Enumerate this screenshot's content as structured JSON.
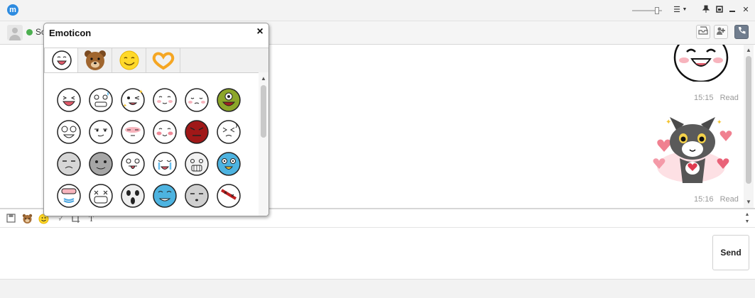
{
  "window": {
    "logo_letter": "m",
    "toolbar_icons": [
      "slider-icon",
      "menu-icon",
      "pin-icon",
      "restore-icon",
      "minimize-icon",
      "close-icon"
    ],
    "close_label": "✕"
  },
  "chat_header": {
    "contact_name": "So",
    "status_color": "#4caf50",
    "action_icons": [
      "inbox-icon",
      "add-contact-icon",
      "call-icon"
    ]
  },
  "messages": [
    {
      "type": "sticker",
      "icon": "smiling-face-sticker",
      "time": "15:15",
      "status": "Read"
    },
    {
      "type": "sticker",
      "icon": "cat-hearts-sticker",
      "time": "15:16",
      "status": "Read"
    }
  ],
  "composer": {
    "tools": [
      "save-icon",
      "bear-icon",
      "smiley-icon",
      "nudge-icon",
      "capture-icon",
      "font-icon"
    ],
    "send_label": "Send"
  },
  "emoticon_panel": {
    "title": "Emoticon",
    "close_label": "×",
    "tabs": [
      {
        "name": "face-set",
        "active": true
      },
      {
        "name": "bear-set",
        "active": false
      },
      {
        "name": "smiley-set",
        "active": false
      },
      {
        "name": "heart-hands-set",
        "active": false
      }
    ],
    "grid": [
      [
        "laughing",
        "sweating",
        "winking",
        "blushing",
        "shy",
        "green-monster"
      ],
      [
        "crying-laugh",
        "smug",
        "blushing-sleepy",
        "blushing-happy",
        "red-angry",
        "dizzy"
      ],
      [
        "grey-annoyed",
        "grey-sick",
        "tongue-out",
        "tearful",
        "shocked",
        "blue-swirl"
      ],
      [
        "blue-mask",
        "masked",
        "scream",
        "blue-crying",
        "grey-bored",
        "bandaged"
      ]
    ]
  }
}
